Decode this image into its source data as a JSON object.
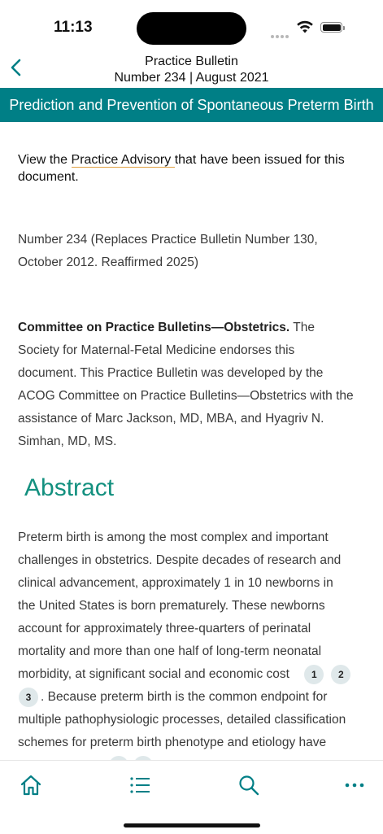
{
  "status_bar": {
    "time": "11:13"
  },
  "nav": {
    "title_line1": "Practice Bulletin",
    "title_line2": "Number 234 | August 2021"
  },
  "banner": {
    "title": "Prediction and Prevention of Spontaneous Preterm Birth"
  },
  "content": {
    "advisory_prefix": "View the ",
    "advisory_link": "Practice Advisory ",
    "advisory_suffix": "that have been issued for this document.",
    "number_line1": "Number 234 (Replaces Practice Bulletin Number 130,",
    "number_line2": "October 2012. Reaffirmed 2025)",
    "committee_bold": "Committee on Practice Bulletins—Obstetrics.",
    "committee_line1": " The",
    "committee_line2": "Society for Maternal-Fetal Medicine endorses this",
    "committee_line3": "document. This Practice Bulletin was developed by the",
    "committee_line4": "ACOG Committee on Practice Bulletins—Obstetrics with the",
    "committee_line5": "assistance of Marc Jackson, MD, MBA, and Hyagriv N.",
    "committee_line6": "Simhan, MD, MS.",
    "abstract_heading": "Abstract",
    "abstract_line1": "Preterm birth is among the most complex and important",
    "abstract_line2": "challenges in obstetrics. Despite decades of research and",
    "abstract_line3": "clinical advancement, approximately 1 in 10 newborns in",
    "abstract_line4": "the United States is born prematurely. These newborns",
    "abstract_line5": "account for approximately three-quarters of perinatal",
    "abstract_line6": "mortality and more than one half of long-term neonatal",
    "abstract_line7": "morbidity, at significant social and economic cost",
    "abstract_line8": ". Because preterm birth is the common endpoint for",
    "abstract_line9": "multiple pathophysiologic processes, detailed classification",
    "abstract_line10": "schemes for preterm birth phenotype and etiology have",
    "citations": [
      "1",
      "2",
      "3"
    ]
  },
  "tab_bar": {
    "icons": [
      "home-icon",
      "list-icon",
      "search-icon",
      "more-icon"
    ]
  },
  "colors": {
    "accent": "#007f86",
    "heading": "#13907f",
    "link_underline": "#e0a040"
  }
}
